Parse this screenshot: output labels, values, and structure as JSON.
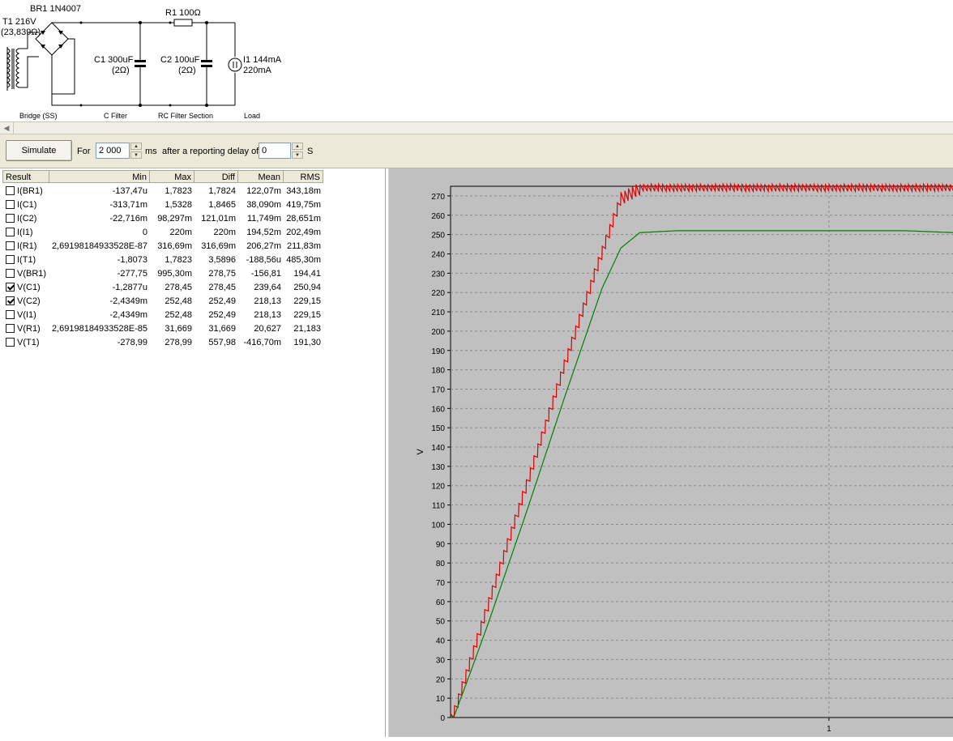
{
  "schematic": {
    "br1_label": "BR1 1N4007",
    "t1_label": "T1 216V",
    "t1_res": "(23,839Ω)",
    "r1_label": "R1 100Ω",
    "c1_label": "C1 300uF",
    "c1_res": "(2Ω)",
    "c2_label": "C2 100uF",
    "c2_res": "(2Ω)",
    "i1_label": "I1 144mA",
    "i1_value": "220mA",
    "section_bridge": "Bridge (SS)",
    "section_cfilter": "C Filter",
    "section_rcfilter": "RC Filter Section",
    "section_load": "Load"
  },
  "toolbar": {
    "simulate_label": "Simulate",
    "for_label": "For",
    "duration_value": "2 000",
    "ms_label": "ms",
    "delay_label": "after a reporting delay of",
    "delay_value": "0",
    "s_label": "S"
  },
  "table": {
    "headers": [
      "Result",
      "Min",
      "Max",
      "Diff",
      "Mean",
      "RMS"
    ],
    "rows": [
      {
        "name": "I(BR1)",
        "checked": false,
        "min": "-137,47u",
        "max": "1,7823",
        "diff": "1,7824",
        "mean": "122,07m",
        "rms": "343,18m"
      },
      {
        "name": "I(C1)",
        "checked": false,
        "min": "-313,71m",
        "max": "1,5328",
        "diff": "1,8465",
        "mean": "38,090m",
        "rms": "419,75m"
      },
      {
        "name": "I(C2)",
        "checked": false,
        "min": "-22,716m",
        "max": "98,297m",
        "diff": "121,01m",
        "mean": "11,749m",
        "rms": "28,651m"
      },
      {
        "name": "I(I1)",
        "checked": false,
        "min": "0",
        "max": "220m",
        "diff": "220m",
        "mean": "194,52m",
        "rms": "202,49m"
      },
      {
        "name": "I(R1)",
        "checked": false,
        "min": "2,69198184933528E-87",
        "max": "316,69m",
        "diff": "316,69m",
        "mean": "206,27m",
        "rms": "211,83m"
      },
      {
        "name": "I(T1)",
        "checked": false,
        "min": "-1,8073",
        "max": "1,7823",
        "diff": "3,5896",
        "mean": "-188,56u",
        "rms": "485,30m"
      },
      {
        "name": "V(BR1)",
        "checked": false,
        "min": "-277,75",
        "max": "995,30m",
        "diff": "278,75",
        "mean": "-156,81",
        "rms": "194,41"
      },
      {
        "name": "V(C1)",
        "checked": true,
        "min": "-1,2877u",
        "max": "278,45",
        "diff": "278,45",
        "mean": "239,64",
        "rms": "250,94"
      },
      {
        "name": "V(C2)",
        "checked": true,
        "min": "-2,4349m",
        "max": "252,48",
        "diff": "252,49",
        "mean": "218,13",
        "rms": "229,15"
      },
      {
        "name": "V(I1)",
        "checked": false,
        "min": "-2,4349m",
        "max": "252,48",
        "diff": "252,49",
        "mean": "218,13",
        "rms": "229,15"
      },
      {
        "name": "V(R1)",
        "checked": false,
        "min": "2,69198184933528E-85",
        "max": "31,669",
        "diff": "31,669",
        "mean": "20,627",
        "rms": "21,183"
      },
      {
        "name": "V(T1)",
        "checked": false,
        "min": "-278,99",
        "max": "278,99",
        "diff": "557,98",
        "mean": "-416,70m",
        "rms": "191,30"
      }
    ]
  },
  "chart_data": {
    "type": "line",
    "ylabel": "V",
    "ylim": [
      0,
      275
    ],
    "yticks": [
      0,
      10,
      20,
      30,
      40,
      50,
      60,
      70,
      80,
      90,
      100,
      110,
      120,
      130,
      140,
      150,
      160,
      170,
      180,
      190,
      200,
      210,
      220,
      230,
      240,
      250,
      260,
      270
    ],
    "xticks": [
      1
    ],
    "grid": true,
    "series": [
      {
        "color": "#dd0000",
        "ripple": 7,
        "points": [
          [
            0,
            0
          ],
          [
            0.01,
            4
          ],
          [
            0.1,
            60
          ],
          [
            0.2,
            121
          ],
          [
            0.3,
            183
          ],
          [
            0.4,
            242
          ],
          [
            0.45,
            270
          ],
          [
            0.5,
            275
          ],
          [
            0.6,
            275
          ],
          [
            0.8,
            275
          ],
          [
            1.0,
            275
          ],
          [
            1.2,
            275
          ],
          [
            1.33,
            275
          ]
        ]
      },
      {
        "color": "#008000",
        "ripple": 0,
        "points": [
          [
            0,
            0
          ],
          [
            0.01,
            1
          ],
          [
            0.05,
            22
          ],
          [
            0.1,
            49
          ],
          [
            0.2,
            106
          ],
          [
            0.3,
            165
          ],
          [
            0.4,
            222
          ],
          [
            0.45,
            243
          ],
          [
            0.5,
            251
          ],
          [
            0.6,
            252
          ],
          [
            0.8,
            252
          ],
          [
            1.0,
            252
          ],
          [
            1.2,
            252
          ],
          [
            1.33,
            251
          ]
        ]
      }
    ]
  }
}
